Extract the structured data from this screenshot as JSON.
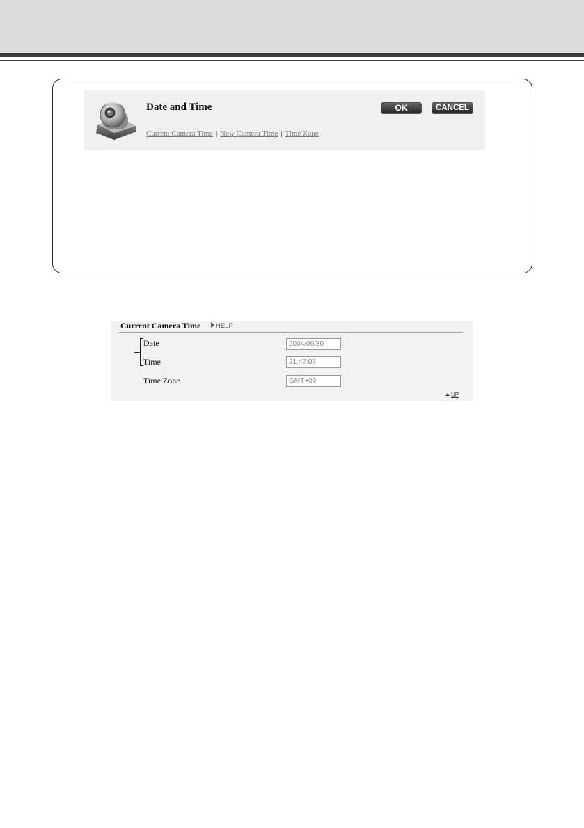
{
  "dialog": {
    "title": "Date and Time",
    "ok_label": "OK",
    "cancel_label": "CANCEL",
    "links": [
      "Current Camera Time",
      "New Camera Time",
      "Time Zone"
    ],
    "separator": "|"
  },
  "section": {
    "title": "Current Camera Time",
    "help_label": "HELP",
    "up_label": "UP",
    "fields": [
      {
        "label": "Date",
        "value": "2004/09/30"
      },
      {
        "label": "Time",
        "value": "21:47:07"
      },
      {
        "label": "Time Zone",
        "value": "GMT+09"
      }
    ]
  },
  "icons": {
    "camera": "camera-icon",
    "help_arrow": "triangle-right-icon",
    "up_arrow": "triangle-up-icon"
  }
}
